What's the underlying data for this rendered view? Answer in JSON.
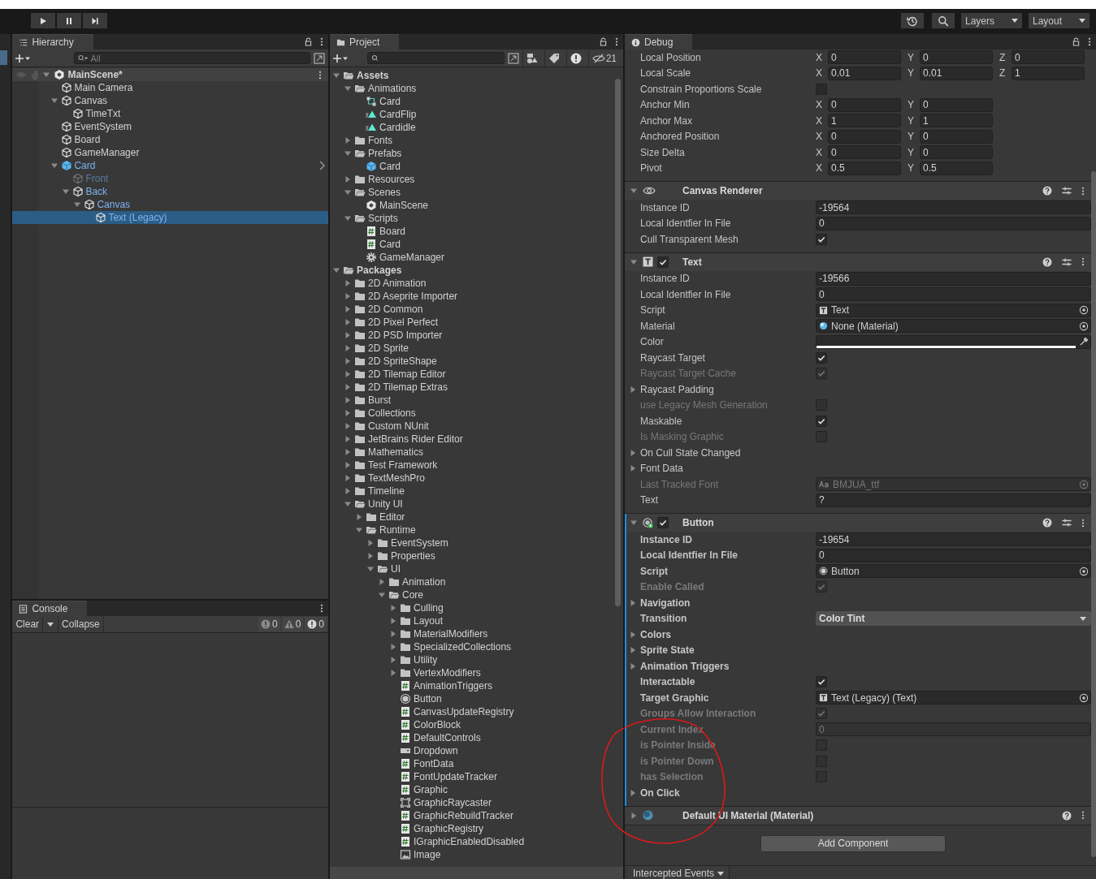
{
  "toolbar": {
    "play_controls": [
      {
        "kind": "play"
      },
      {
        "kind": "pause"
      },
      {
        "kind": "step"
      }
    ],
    "tools": [
      {
        "kind": "history"
      },
      {
        "kind": "search"
      }
    ],
    "layers": "Layers",
    "layout": "Layout"
  },
  "hierarchy": {
    "tab": "Hierarchy",
    "search_placeholder": "All",
    "items": [
      {
        "kind": "scene",
        "label": "MainScene*",
        "expanded": true,
        "selected": false,
        "active": true,
        "children": [
          {
            "kind": "object",
            "label": "Main Camera",
            "selected": false,
            "active": true
          },
          {
            "kind": "object",
            "label": "Canvas",
            "expanded": true,
            "selected": false,
            "active": true,
            "children": [
              {
                "kind": "object",
                "label": "TimeTxt",
                "selected": false,
                "active": true
              }
            ]
          },
          {
            "kind": "object",
            "label": "EventSystem",
            "selected": false,
            "active": true
          },
          {
            "kind": "object",
            "label": "Board",
            "selected": false,
            "active": true
          },
          {
            "kind": "object",
            "label": "GameManager",
            "selected": false,
            "active": true
          },
          {
            "kind": "prefab_root",
            "label": "Card",
            "expanded": true,
            "selected": false,
            "active": true,
            "children": [
              {
                "kind": "prefab_child",
                "label": "Front",
                "selected": false,
                "active": false
              },
              {
                "kind": "prefab_child",
                "label": "Back",
                "expanded": true,
                "selected": false,
                "active": true,
                "children": [
                  {
                    "kind": "prefab_child",
                    "label": "Canvas",
                    "expanded": true,
                    "selected": false,
                    "active": true,
                    "children": [
                      {
                        "kind": "prefab_child",
                        "label": "Text (Legacy)",
                        "selected": true,
                        "active": true
                      }
                    ]
                  }
                ]
              }
            ]
          }
        ]
      }
    ]
  },
  "console": {
    "tab": "Console",
    "clear": "Clear",
    "collapse": "Collapse",
    "counts": [
      {
        "kind": "info",
        "count": "0"
      },
      {
        "kind": "warning",
        "count": "0"
      },
      {
        "kind": "error",
        "count": "0"
      }
    ]
  },
  "project": {
    "tab": "Project",
    "hidden_count": "21",
    "items": [
      {
        "kind": "folder",
        "label": "Assets",
        "bold": true,
        "expanded": true,
        "children": [
          {
            "kind": "folder",
            "label": "Animations",
            "expanded": true,
            "children": [
              {
                "kind": "controller",
                "label": "Card"
              },
              {
                "kind": "clip",
                "label": "CardFlip"
              },
              {
                "kind": "clip",
                "label": "Cardidle"
              }
            ]
          },
          {
            "kind": "folder",
            "label": "Fonts",
            "expanded": false
          },
          {
            "kind": "folder",
            "label": "Prefabs",
            "expanded": true,
            "children": [
              {
                "kind": "prefab",
                "label": "Card"
              }
            ]
          },
          {
            "kind": "folder",
            "label": "Resources",
            "expanded": false
          },
          {
            "kind": "folder",
            "label": "Scenes",
            "expanded": true,
            "children": [
              {
                "kind": "scene",
                "label": "MainScene"
              }
            ]
          },
          {
            "kind": "folder",
            "label": "Scripts",
            "expanded": true,
            "children": [
              {
                "kind": "script",
                "label": "Board"
              },
              {
                "kind": "script",
                "label": "Card"
              },
              {
                "kind": "settings",
                "label": "GameManager"
              }
            ]
          }
        ]
      },
      {
        "kind": "folder",
        "label": "Packages",
        "bold": true,
        "expanded": true,
        "children": [
          {
            "kind": "folder",
            "label": "2D Animation",
            "expanded": false
          },
          {
            "kind": "folder",
            "label": "2D Aseprite Importer",
            "expanded": false
          },
          {
            "kind": "folder",
            "label": "2D Common",
            "expanded": false
          },
          {
            "kind": "folder",
            "label": "2D Pixel Perfect",
            "expanded": false
          },
          {
            "kind": "folder",
            "label": "2D PSD Importer",
            "expanded": false
          },
          {
            "kind": "folder",
            "label": "2D Sprite",
            "expanded": false
          },
          {
            "kind": "folder",
            "label": "2D SpriteShape",
            "expanded": false
          },
          {
            "kind": "folder",
            "label": "2D Tilemap Editor",
            "expanded": false
          },
          {
            "kind": "folder",
            "label": "2D Tilemap Extras",
            "expanded": false
          },
          {
            "kind": "folder",
            "label": "Burst",
            "expanded": false
          },
          {
            "kind": "folder",
            "label": "Collections",
            "expanded": false
          },
          {
            "kind": "folder",
            "label": "Custom NUnit",
            "expanded": false
          },
          {
            "kind": "folder",
            "label": "JetBrains Rider Editor",
            "expanded": false
          },
          {
            "kind": "folder",
            "label": "Mathematics",
            "expanded": false
          },
          {
            "kind": "folder",
            "label": "Test Framework",
            "expanded": false
          },
          {
            "kind": "folder",
            "label": "TextMeshPro",
            "expanded": false
          },
          {
            "kind": "folder",
            "label": "Timeline",
            "expanded": false
          },
          {
            "kind": "folder",
            "label": "Unity UI",
            "expanded": true,
            "children": [
              {
                "kind": "folder",
                "label": "Editor",
                "expanded": false
              },
              {
                "kind": "folder",
                "label": "Runtime",
                "expanded": true,
                "children": [
                  {
                    "kind": "folder",
                    "label": "EventSystem",
                    "expanded": false
                  },
                  {
                    "kind": "folder",
                    "label": "Properties",
                    "expanded": false
                  },
                  {
                    "kind": "folder",
                    "label": "UI",
                    "expanded": true,
                    "children": [
                      {
                        "kind": "folder",
                        "label": "Animation",
                        "expanded": false
                      },
                      {
                        "kind": "folder",
                        "label": "Core",
                        "expanded": true,
                        "children": [
                          {
                            "kind": "folder",
                            "label": "Culling",
                            "expanded": false
                          },
                          {
                            "kind": "folder",
                            "label": "Layout",
                            "expanded": false
                          },
                          {
                            "kind": "folder",
                            "label": "MaterialModifiers",
                            "expanded": false
                          },
                          {
                            "kind": "folder",
                            "label": "SpecializedCollections",
                            "expanded": false
                          },
                          {
                            "kind": "folder",
                            "label": "Utility",
                            "expanded": false
                          },
                          {
                            "kind": "folder",
                            "label": "VertexModifiers",
                            "expanded": false
                          },
                          {
                            "kind": "script",
                            "label": "AnimationTriggers"
                          },
                          {
                            "kind": "button",
                            "label": "Button"
                          },
                          {
                            "kind": "script",
                            "label": "CanvasUpdateRegistry"
                          },
                          {
                            "kind": "script",
                            "label": "ColorBlock"
                          },
                          {
                            "kind": "script",
                            "label": "DefaultControls"
                          },
                          {
                            "kind": "dropdown",
                            "label": "Dropdown"
                          },
                          {
                            "kind": "script",
                            "label": "FontData"
                          },
                          {
                            "kind": "script",
                            "label": "FontUpdateTracker"
                          },
                          {
                            "kind": "script",
                            "label": "Graphic"
                          },
                          {
                            "kind": "raycaster",
                            "label": "GraphicRaycaster"
                          },
                          {
                            "kind": "script",
                            "label": "GraphicRebuildTracker"
                          },
                          {
                            "kind": "script",
                            "label": "GraphicRegistry"
                          },
                          {
                            "kind": "script",
                            "label": "IGraphicEnabledDisabled"
                          },
                          {
                            "kind": "image",
                            "label": "Image"
                          }
                        ]
                      }
                    ]
                  }
                ]
              }
            ]
          }
        ]
      }
    ]
  },
  "inspector": {
    "tab": "Debug",
    "rows": [
      {
        "kind": "vector",
        "label": "Local Position",
        "disabled": false,
        "fields": [
          {
            "axis": "X",
            "value": "0"
          },
          {
            "axis": "Y",
            "value": "0"
          },
          {
            "axis": "Z",
            "value": "0"
          }
        ]
      },
      {
        "kind": "vector",
        "label": "Local Scale",
        "disabled": false,
        "fields": [
          {
            "axis": "X",
            "value": "0.01"
          },
          {
            "axis": "Y",
            "value": "0.01"
          },
          {
            "axis": "Z",
            "value": "1"
          }
        ]
      },
      {
        "kind": "checkbox",
        "label": "Constrain Proportions Scale",
        "disabled": false,
        "checked": false
      },
      {
        "kind": "vector",
        "label": "Anchor Min",
        "disabled": false,
        "fields": [
          {
            "axis": "X",
            "value": "0"
          },
          {
            "axis": "Y",
            "value": "0"
          }
        ]
      },
      {
        "kind": "vector",
        "label": "Anchor Max",
        "disabled": false,
        "fields": [
          {
            "axis": "X",
            "value": "1"
          },
          {
            "axis": "Y",
            "value": "1"
          }
        ]
      },
      {
        "kind": "vector",
        "label": "Anchored Position",
        "disabled": false,
        "fields": [
          {
            "axis": "X",
            "value": "0"
          },
          {
            "axis": "Y",
            "value": "0"
          }
        ]
      },
      {
        "kind": "vector",
        "label": "Size Delta",
        "disabled": false,
        "fields": [
          {
            "axis": "X",
            "value": "0"
          },
          {
            "axis": "Y",
            "value": "0"
          }
        ]
      },
      {
        "kind": "vector",
        "label": "Pivot",
        "disabled": false,
        "fields": [
          {
            "axis": "X",
            "value": "0.5"
          },
          {
            "axis": "Y",
            "value": "0.5"
          }
        ]
      }
    ],
    "components": [
      {
        "kind": "canvas_renderer",
        "title": "Canvas Renderer",
        "expanded": true,
        "overridden": false,
        "rows": [
          {
            "kind": "text",
            "label": "Instance ID",
            "value": "-19564",
            "disabled": false
          },
          {
            "kind": "text",
            "label": "Local Identfier In File",
            "value": "0",
            "disabled": false
          },
          {
            "kind": "checkbox",
            "label": "Cull Transparent Mesh",
            "checked": true,
            "disabled": false
          }
        ]
      },
      {
        "kind": "text",
        "title": "Text",
        "enabled": true,
        "expanded": true,
        "overridden": false,
        "rows": [
          {
            "kind": "text",
            "label": "Instance ID",
            "value": "-19566",
            "disabled": false
          },
          {
            "kind": "text",
            "label": "Local Identfier In File",
            "value": "0",
            "disabled": false
          },
          {
            "kind": "text_ref",
            "label": "Script",
            "value": "Text",
            "disabled": false
          },
          {
            "kind": "material_ref",
            "label": "Material",
            "value": "None (Material)",
            "disabled": false
          },
          {
            "kind": "color",
            "label": "Color",
            "color": "#2a2a2a",
            "disabled": false
          },
          {
            "kind": "checkbox",
            "label": "Raycast Target",
            "checked": true,
            "disabled": false
          },
          {
            "kind": "checkbox",
            "label": "Raycast Target Cache",
            "checked": true,
            "disabled": true
          },
          {
            "kind": "foldout",
            "label": "Raycast Padding",
            "expanded": false,
            "disabled": false
          },
          {
            "kind": "checkbox",
            "label": "use Legacy Mesh Generation",
            "checked": false,
            "disabled": true
          },
          {
            "kind": "checkbox",
            "label": "Maskable",
            "checked": true,
            "disabled": false
          },
          {
            "kind": "checkbox",
            "label": "Is Masking Graphic",
            "checked": false,
            "disabled": true
          },
          {
            "kind": "foldout",
            "label": "On Cull State Changed",
            "expanded": false,
            "disabled": false
          },
          {
            "kind": "foldout",
            "label": "Font Data",
            "expanded": false,
            "disabled": false
          },
          {
            "kind": "font_ref",
            "label": "Last Tracked Font",
            "value": "BMJUA_ttf",
            "disabled": true
          },
          {
            "kind": "text",
            "label": "Text",
            "value": "?",
            "disabled": false
          }
        ]
      },
      {
        "kind": "button",
        "title": "Button",
        "enabled": true,
        "expanded": true,
        "overridden": true,
        "rows": [
          {
            "kind": "text",
            "label": "Instance ID",
            "value": "-19654",
            "disabled": false
          },
          {
            "kind": "text",
            "label": "Local Identfier In File",
            "value": "0",
            "disabled": false
          },
          {
            "kind": "button_ref",
            "label": "Script",
            "value": "Button",
            "disabled": false
          },
          {
            "kind": "checkbox",
            "label": "Enable Called",
            "checked": true,
            "disabled": true
          },
          {
            "kind": "foldout",
            "label": "Navigation",
            "expanded": false,
            "disabled": false
          },
          {
            "kind": "dropdown",
            "label": "Transition",
            "value": "Color Tint",
            "disabled": false
          },
          {
            "kind": "foldout",
            "label": "Colors",
            "expanded": false,
            "disabled": false
          },
          {
            "kind": "foldout",
            "label": "Sprite State",
            "expanded": false,
            "disabled": false
          },
          {
            "kind": "foldout",
            "label": "Animation Triggers",
            "expanded": false,
            "disabled": false
          },
          {
            "kind": "checkbox",
            "label": "Interactable",
            "checked": true,
            "disabled": false
          },
          {
            "kind": "text_ref",
            "label": "Target Graphic",
            "value": "Text (Legacy) (Text)",
            "disabled": false
          },
          {
            "kind": "checkbox",
            "label": "Groups Allow Interaction",
            "checked": true,
            "disabled": true
          },
          {
            "kind": "text",
            "label": "Current Index",
            "value": "0",
            "disabled": true
          },
          {
            "kind": "checkbox",
            "label": "is Pointer Inside",
            "checked": false,
            "disabled": true
          },
          {
            "kind": "checkbox",
            "label": "is Pointer Down",
            "checked": false,
            "disabled": true
          },
          {
            "kind": "checkbox",
            "label": "has Selection",
            "checked": false,
            "disabled": true
          },
          {
            "kind": "foldout",
            "label": "On Click",
            "expanded": false,
            "disabled": false
          }
        ]
      },
      {
        "kind": "material",
        "title": "Default UI Material (Material)",
        "expanded": false,
        "overridden": false
      }
    ],
    "add_component": "Add Component",
    "intercepted_events": "Intercepted Events"
  },
  "annotation": {
    "kind": "circle"
  }
}
